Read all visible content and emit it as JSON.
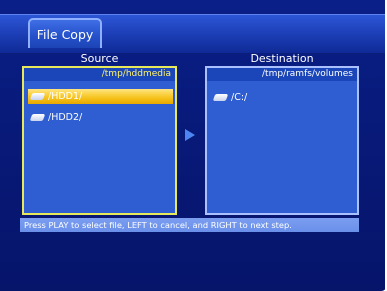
{
  "window": {
    "tab_title": "File Copy"
  },
  "source": {
    "header": "Source",
    "path": "/tmp/hddmedia",
    "items": [
      {
        "label": "/HDD1/",
        "icon": "hard-disk-icon",
        "selected": true
      },
      {
        "label": "/HDD2/",
        "icon": "hard-disk-icon",
        "selected": false
      }
    ]
  },
  "destination": {
    "header": "Destination",
    "path": "/tmp/ramfs/volumes",
    "items": [
      {
        "label": "/C:/",
        "icon": "hard-disk-icon",
        "selected": false
      }
    ]
  },
  "status": {
    "help_text": "Press PLAY to select file, LEFT to cancel, and RIGHT to next step."
  },
  "colors": {
    "background": "#0a1f88",
    "panel": "#2e5ed1",
    "active_border": "#e7e85a",
    "selection": "#f6c21a",
    "status_bar": "#7b9ef0"
  }
}
